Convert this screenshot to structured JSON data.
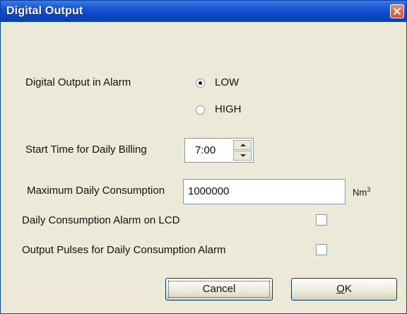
{
  "window": {
    "title": "Digital Output"
  },
  "form": {
    "alarm_label": "Digital Output in Alarm",
    "radio_low": "LOW",
    "radio_high": "HIGH",
    "billing_label": "Start Time for Daily Billing",
    "billing_value": "7:00",
    "max_label": "Maximum Daily Consumption",
    "max_value": "1000000",
    "unit": "Nm",
    "unit_sup": "3",
    "lcd_label": "Daily Consumption Alarm on LCD",
    "pulses_label": "Output Pulses for Daily Consumption Alarm",
    "selected_radio": "LOW",
    "lcd_checked": false,
    "pulses_checked": false
  },
  "buttons": {
    "cancel": "Cancel",
    "ok_mnemonic": "O",
    "ok_rest": "K"
  },
  "icons": {
    "close": "close-icon",
    "spin_up": "arrow-up-icon",
    "spin_down": "arrow-down-icon"
  },
  "colors": {
    "titlebar": "#0a46c4",
    "close": "#d3502f",
    "background": "#ece9d8",
    "field_border": "#7f9db9"
  }
}
